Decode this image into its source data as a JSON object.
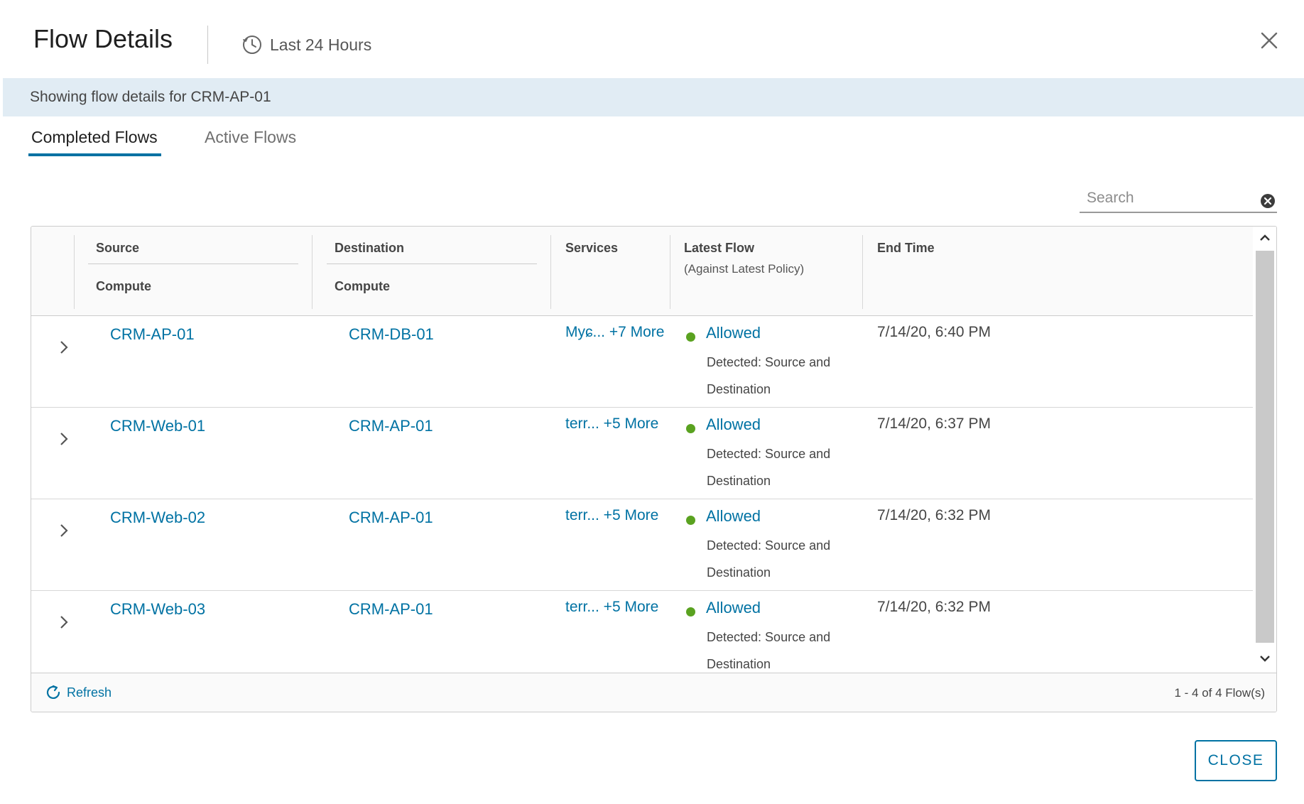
{
  "dialog": {
    "title": "Flow Details",
    "time_range": "Last 24 Hours",
    "banner": "Showing flow details for CRM-AP-01"
  },
  "tabs": [
    {
      "label": "Completed Flows",
      "active": true
    },
    {
      "label": "Active Flows",
      "active": false
    }
  ],
  "search": {
    "placeholder": "Search",
    "value": ""
  },
  "table": {
    "headers": {
      "source": "Source",
      "source_sub": "Compute",
      "destination": "Destination",
      "destination_sub": "Compute",
      "services": "Services",
      "latest_flow": "Latest Flow",
      "latest_flow_sub": "(Against Latest Policy)",
      "end_time": "End Time"
    },
    "rows": [
      {
        "source": "CRM-AP-01",
        "destination": "CRM-DB-01",
        "services": "Myɕ... +7 More",
        "status": "Allowed",
        "detected": "Detected: Source and Destination",
        "end_time": "7/14/20, 6:40 PM"
      },
      {
        "source": "CRM-Web-01",
        "destination": "CRM-AP-01",
        "services": "terr... +5 More",
        "status": "Allowed",
        "detected": "Detected: Source and Destination",
        "end_time": "7/14/20, 6:37 PM"
      },
      {
        "source": "CRM-Web-02",
        "destination": "CRM-AP-01",
        "services": "terr... +5 More",
        "status": "Allowed",
        "detected": "Detected: Source and Destination",
        "end_time": "7/14/20, 6:32 PM"
      },
      {
        "source": "CRM-Web-03",
        "destination": "CRM-AP-01",
        "services": "terr... +5 More",
        "status": "Allowed",
        "detected": "Detected: Source and Destination",
        "end_time": "7/14/20, 6:32 PM"
      }
    ],
    "footer": {
      "refresh": "Refresh",
      "pagination": "1 - 4 of 4 Flow(s)"
    }
  },
  "buttons": {
    "close": "CLOSE"
  },
  "colors": {
    "accent": "#0072a3",
    "banner_bg": "#e1ecf4",
    "status_allowed": "#5aa220"
  },
  "icons": [
    "clock-icon",
    "close-icon",
    "search-clear-icon",
    "chevron-right-icon",
    "refresh-icon",
    "scroll-up-icon",
    "scroll-down-icon"
  ]
}
